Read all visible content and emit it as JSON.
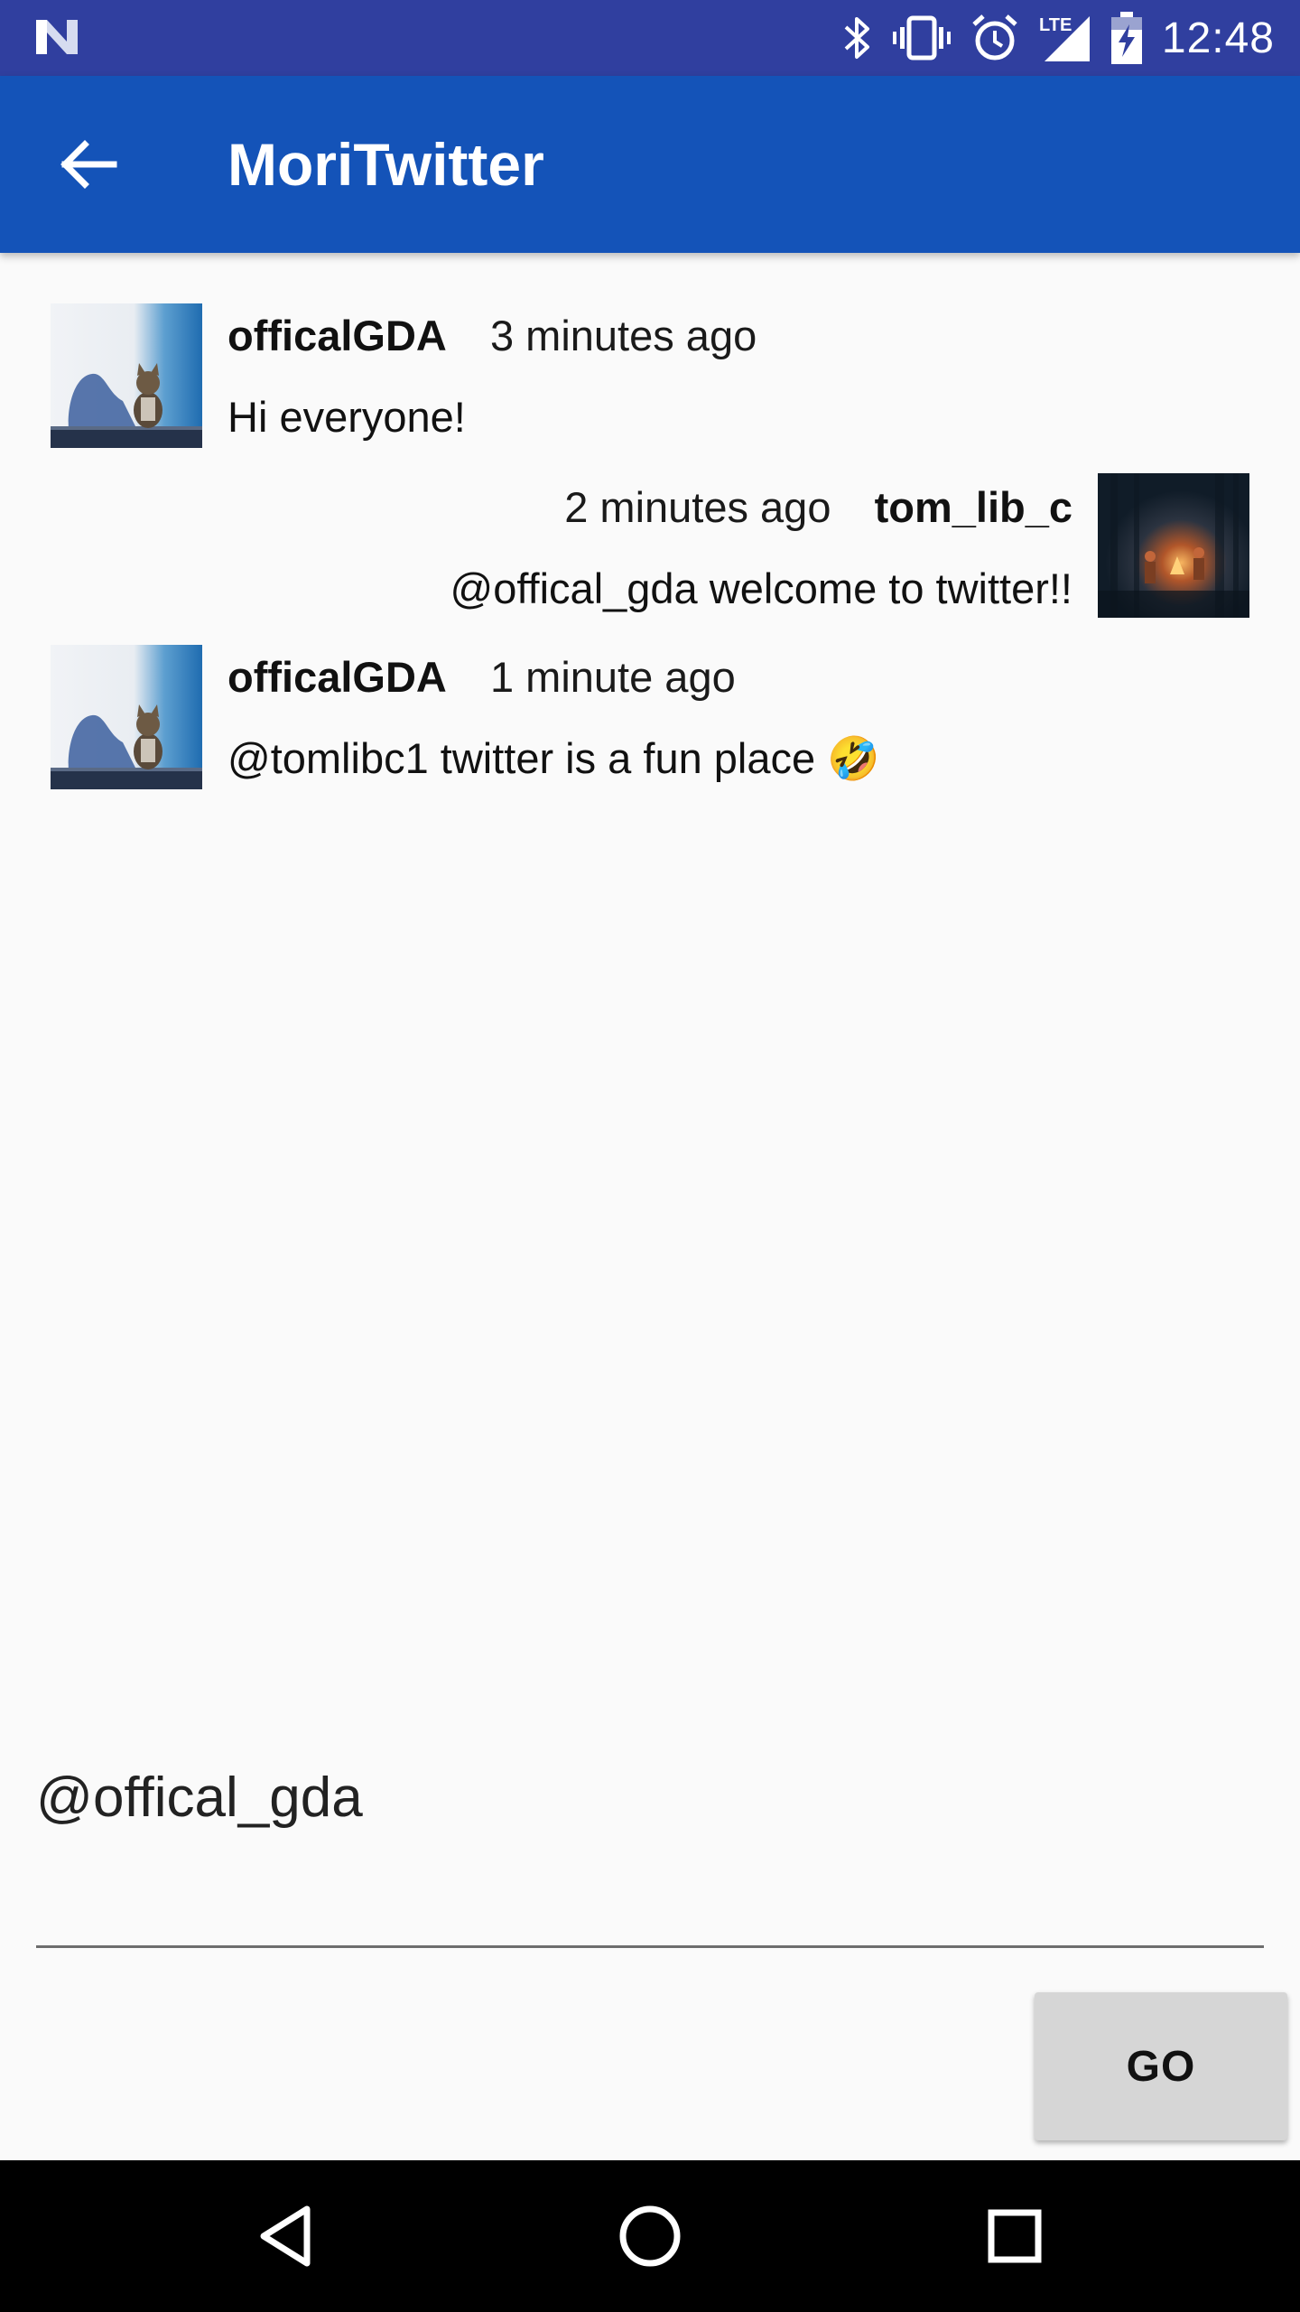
{
  "status_bar": {
    "time": "12:48",
    "network_label": "LTE",
    "icons": [
      "n-logo-icon",
      "bluetooth-icon",
      "vibrate-icon",
      "alarm-icon",
      "signal-icon",
      "battery-charging-icon"
    ]
  },
  "app_bar": {
    "title": "MoriTwitter",
    "back_icon": "arrow-left-icon",
    "color": "#1453b8"
  },
  "messages": [
    {
      "username": "officalGDA",
      "time": "3 minutes ago",
      "text": "Hi everyone!",
      "align": "left",
      "avatar": "cat-photo"
    },
    {
      "username": "tom_lib_c",
      "time": "2 minutes ago",
      "text": "@offical_gda welcome to twitter!!",
      "align": "right",
      "avatar": "campfire-photo"
    },
    {
      "username": "officalGDA",
      "time": "1 minute ago",
      "text": "@tomlibc1 twitter is a fun place",
      "emoji": "🤣",
      "align": "left",
      "avatar": "cat-photo"
    }
  ],
  "composer": {
    "value": "@offical_gda",
    "placeholder": "",
    "go_label": "GO"
  },
  "nav_bar": {
    "icons": [
      "back-triangle-icon",
      "home-circle-icon",
      "recents-square-icon"
    ]
  }
}
